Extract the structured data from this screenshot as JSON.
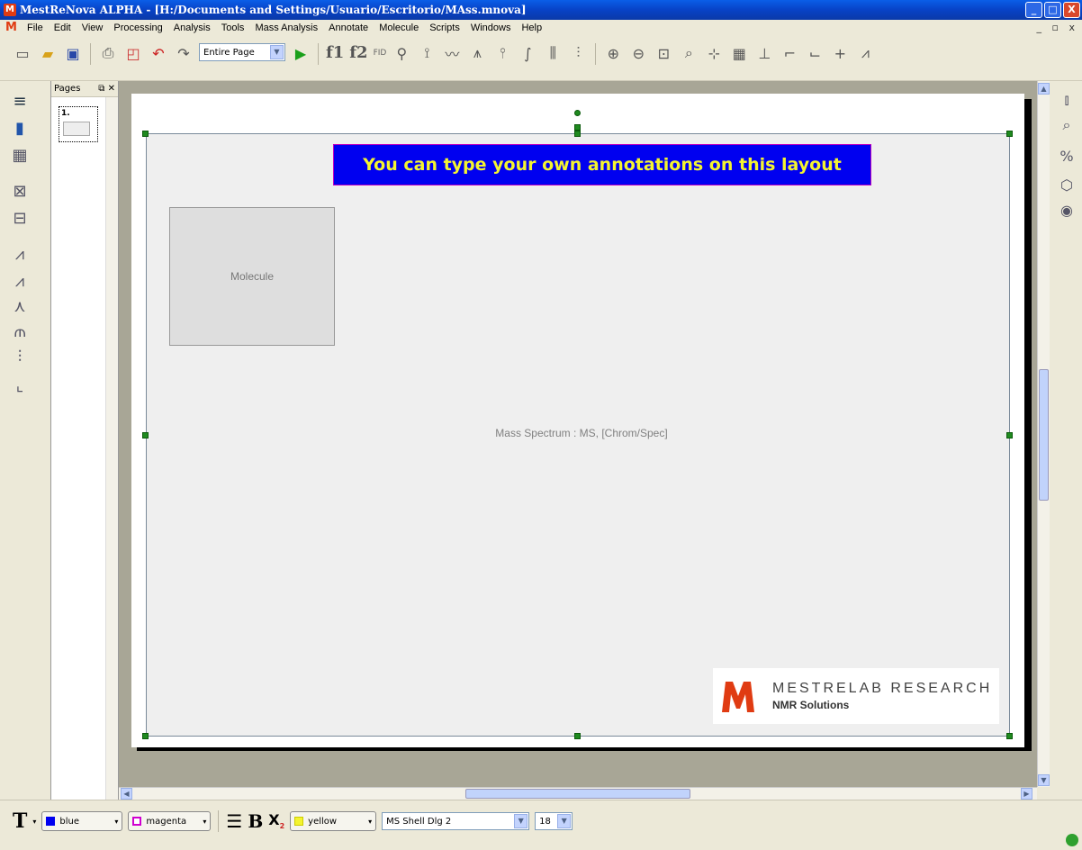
{
  "window": {
    "title": "MestReNova ALPHA - [H:/Documents and Settings/Usuario/Escritorio/MAss.mnova]",
    "buttons": [
      "_",
      "□",
      "X"
    ]
  },
  "menubar": {
    "items": [
      "File",
      "Edit",
      "View",
      "Processing",
      "Analysis",
      "Tools",
      "Mass Analysis",
      "Annotate",
      "Molecule",
      "Scripts",
      "Windows",
      "Help"
    ]
  },
  "toolbar": {
    "zoom_select": "Entire Page",
    "f1": "f1",
    "f2": "f2",
    "fid": "FID"
  },
  "pages_panel": {
    "title": "Pages",
    "page_number": "1."
  },
  "canvas": {
    "annotation_text": "You can type your own annotations on this layout",
    "molecule_label": "Molecule",
    "spectrum_label": "Mass Spectrum : MS, [Chrom/Spec]",
    "logo_title": "MESTRELAB RESEARCH",
    "logo_subtitle": "NMR Solutions"
  },
  "format_bar": {
    "font_color": "blue",
    "fill_color": "magenta",
    "highlight_color": "yellow",
    "font_name": "MS Shell Dlg 2",
    "font_size": "18"
  },
  "colors": {
    "banner_bg": "#0000f0",
    "banner_text": "#f4f430",
    "handle": "#1f8a1f",
    "brand_red": "#e03b12"
  }
}
